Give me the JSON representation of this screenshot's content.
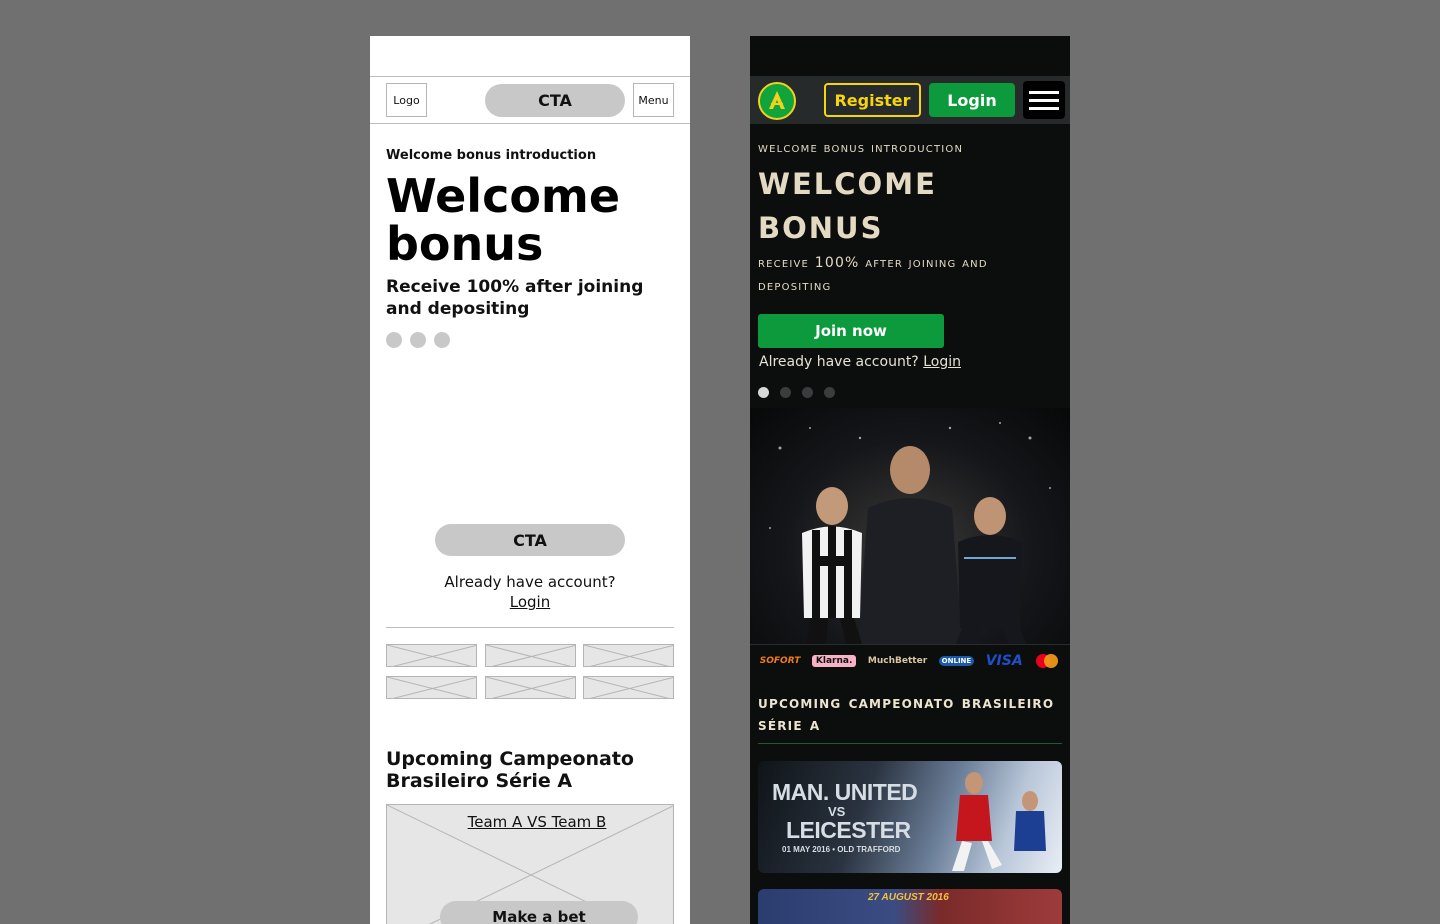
{
  "wireframe": {
    "nav": {
      "logo": "Logo",
      "cta": "CTA",
      "menu": "Menu"
    },
    "intro": "Welcome bonus introduction",
    "headline": "Welcome bonus",
    "subheadline": "Receive 100% after joining and depositing",
    "cta": "CTA",
    "have_account": "Already have account?",
    "login_link": "Login",
    "section_title": "Upcoming Campeonato Brasileiro Série A",
    "match_card": {
      "title": "Team A VS Team B",
      "button": "Make a bet"
    }
  },
  "design": {
    "nav": {
      "register": "Register",
      "login": "Login"
    },
    "intro": "Welcome bonus introduction",
    "headline": "Welcome bonus",
    "subheadline": "Receive 100% after joining and depositing",
    "join": "Join now",
    "have_account": "Already have account?",
    "login_link": "Login",
    "payments": [
      "SOFORT",
      "Klarna.",
      "MuchBetter",
      "ONLINE",
      "VISA"
    ],
    "section_title": "Upcoming Campeonato Brasileiro Série A",
    "match1": {
      "team_a": "MAN. UNITED",
      "vs": "VS",
      "team_b": "LEICESTER",
      "date": "01 MAY 2016 • OLD TRAFFORD"
    },
    "match2": {
      "date": "27 AUGUST 2016"
    },
    "colors": {
      "green": "#0c9a3c",
      "yellow": "#f6d40e",
      "cream": "#e4dac4",
      "background": "#0c0e0d"
    }
  }
}
